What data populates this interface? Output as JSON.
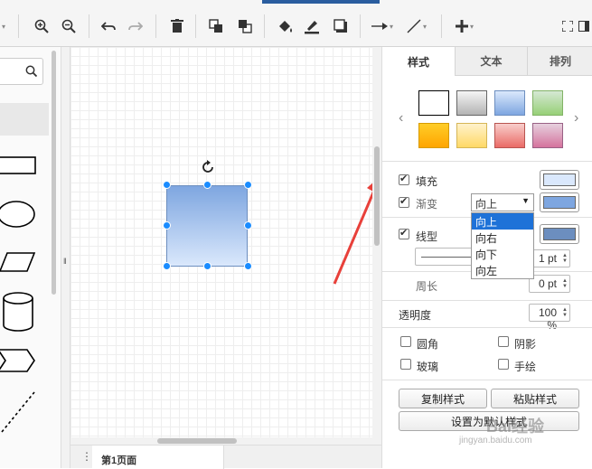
{
  "toolbar": {
    "icons": [
      "menu-caret",
      "zoom-in",
      "zoom-out",
      "undo",
      "redo",
      "delete",
      "to-front",
      "to-back",
      "fill-color",
      "line-color",
      "shadow",
      "connection",
      "waypoints",
      "insert"
    ]
  },
  "left_panel": {
    "search_placeholder": ""
  },
  "canvas": {
    "shape_fill_top": "#7ea6e0",
    "shape_fill_bottom": "#dae8fc",
    "shape_stroke": "#6c8ebf",
    "handle_color": "#1a8cff",
    "arrow_color": "#e8403a"
  },
  "page_tabs": {
    "menu_icon": "⋮",
    "current_page": "第1页面"
  },
  "format_panel": {
    "tabs": [
      {
        "label": "样式",
        "active": true
      },
      {
        "label": "文本",
        "active": false
      },
      {
        "label": "排列",
        "active": false
      }
    ],
    "swatches": [
      {
        "name": "white",
        "top": "#ffffff",
        "bottom": "#ffffff",
        "border": "#000000"
      },
      {
        "name": "gray",
        "top": "#f5f5f5",
        "bottom": "#b3b3b3",
        "border": "#666666"
      },
      {
        "name": "blue",
        "top": "#dae8fc",
        "bottom": "#7ea6e0",
        "border": "#6c8ebf"
      },
      {
        "name": "green",
        "top": "#d5e8d4",
        "bottom": "#97d077",
        "border": "#82b366"
      },
      {
        "name": "orange",
        "top": "#ffcd28",
        "bottom": "#ffa500",
        "border": "#d79b00"
      },
      {
        "name": "yellow",
        "top": "#fff2cc",
        "bottom": "#ffd966",
        "border": "#d6b656"
      },
      {
        "name": "red",
        "top": "#f8cecc",
        "bottom": "#ea6b66",
        "border": "#b85450"
      },
      {
        "name": "purple",
        "top": "#e6d0de",
        "bottom": "#d5739d",
        "border": "#996185"
      }
    ],
    "fill": {
      "label": "填充",
      "checked": true,
      "color": "#dae8fc"
    },
    "gradient": {
      "label": "渐变",
      "checked": true,
      "color": "#7ea6e0",
      "selected": "向上",
      "options": [
        "向上",
        "向右",
        "向下",
        "向左"
      ]
    },
    "line": {
      "label": "线型",
      "checked": true,
      "color": "#6c8ebf",
      "width": "1 pt"
    },
    "perimeter": {
      "label": "周长",
      "value": "0 pt"
    },
    "opacity": {
      "label": "透明度",
      "value": "100 %"
    },
    "options": [
      {
        "label": "圆角",
        "checked": false
      },
      {
        "label": "阴影",
        "checked": false
      },
      {
        "label": "玻璃",
        "checked": false
      },
      {
        "label": "手绘",
        "checked": false
      }
    ],
    "buttons": {
      "copy_style": "复制样式",
      "paste_style": "粘贴样式",
      "set_default": "设置为默认样式"
    }
  },
  "watermark": {
    "logo": "Bai经验",
    "url": "jingyan.baidu.com"
  }
}
